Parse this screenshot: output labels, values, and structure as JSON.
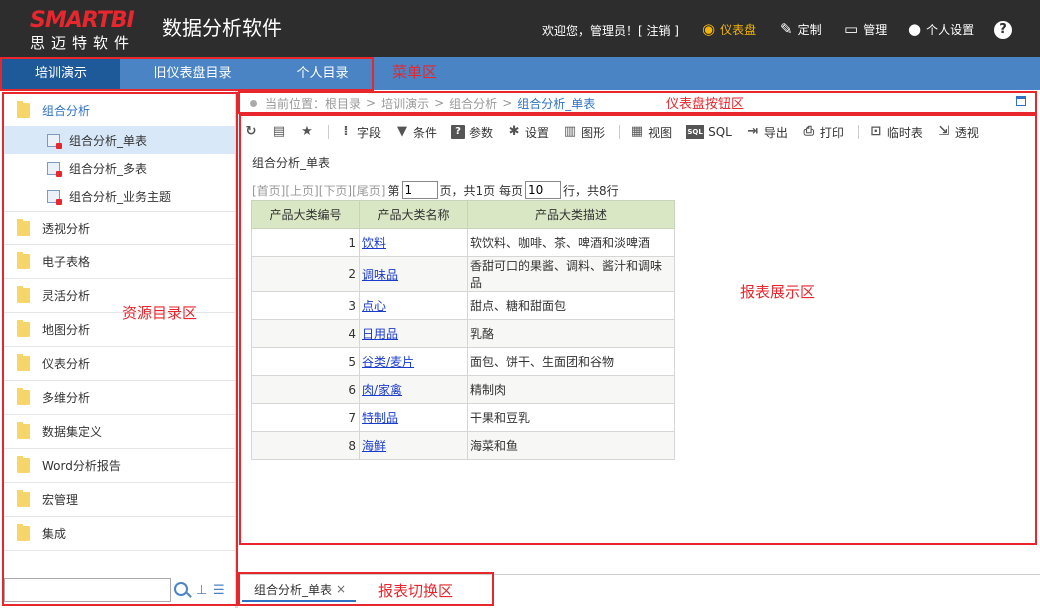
{
  "header": {
    "logo_brand": "SMARTBI",
    "logo_sub": "思迈特软件",
    "app_title": "数据分析软件",
    "welcome": "欢迎您，管理员！[ 注销 ]",
    "nav": {
      "dashboard": "仪表盘",
      "custom": "定制",
      "manage": "管理",
      "personal": "个人设置"
    },
    "help": "?"
  },
  "menubar": {
    "tabs": [
      "培训演示",
      "旧仪表盘目录",
      "个人目录"
    ],
    "active_index": 0
  },
  "annotations": {
    "menu_area": "菜单区",
    "dashboard_buttons_area": "仪表盘按钮区",
    "resource_directory_area": "资源目录区",
    "report_display_area": "报表展示区",
    "report_switch_area": "报表切换区"
  },
  "sidebar": {
    "open_folder": "组合分析",
    "children": [
      "组合分析_单表",
      "组合分析_多表",
      "组合分析_业务主题"
    ],
    "selected_child": 0,
    "folders": [
      "透视分析",
      "电子表格",
      "灵活分析",
      "地图分析",
      "仪表分析",
      "多维分析",
      "数据集定义",
      "Word分析报告",
      "宏管理",
      "集成"
    ],
    "search_placeholder": ""
  },
  "breadcrumb": {
    "prefix": "当前位置：",
    "path": [
      "根目录",
      "培训演示",
      "组合分析"
    ],
    "separator": ">",
    "current": "组合分析_单表"
  },
  "toolbar": {
    "items": [
      "字段",
      "条件",
      "参数",
      "设置",
      "图形",
      "视图",
      "SQL",
      "导出",
      "打印",
      "临时表",
      "透视"
    ]
  },
  "report": {
    "title": "组合分析_单表",
    "pager": {
      "first": "[首页]",
      "prev": "[上页]",
      "next": "[下页]",
      "last": "[尾页]",
      "page_label": "第",
      "page_value": "1",
      "total_pages": "页，共1页 每页",
      "per_page_value": "10",
      "rows_label": "行，共8行"
    },
    "columns": [
      "产品大类编号",
      "产品大类名称",
      "产品大类描述"
    ],
    "rows": [
      [
        "1",
        "饮料",
        "软饮料、咖啡、茶、啤酒和淡啤酒"
      ],
      [
        "2",
        "调味品",
        "香甜可口的果酱、调料、酱汁和调味品"
      ],
      [
        "3",
        "点心",
        "甜点、糖和甜面包"
      ],
      [
        "4",
        "日用品",
        "乳酪"
      ],
      [
        "5",
        "谷类/麦片",
        "面包、饼干、生面团和谷物"
      ],
      [
        "6",
        "肉/家禽",
        "精制肉"
      ],
      [
        "7",
        "特制品",
        "干果和豆乳"
      ],
      [
        "8",
        "海鲜",
        "海菜和鱼"
      ]
    ]
  },
  "bottom": {
    "tab_label": "组合分析_单表",
    "close": "×"
  },
  "colors": {
    "header_bg": "#2d2d2d",
    "menubar_bg": "#4a84c4",
    "active_tab_bg": "#1e5a9a",
    "brand_red": "#e8262d",
    "dashboard_accent": "#f4b400",
    "table_header_bg": "#d9e7c4"
  }
}
